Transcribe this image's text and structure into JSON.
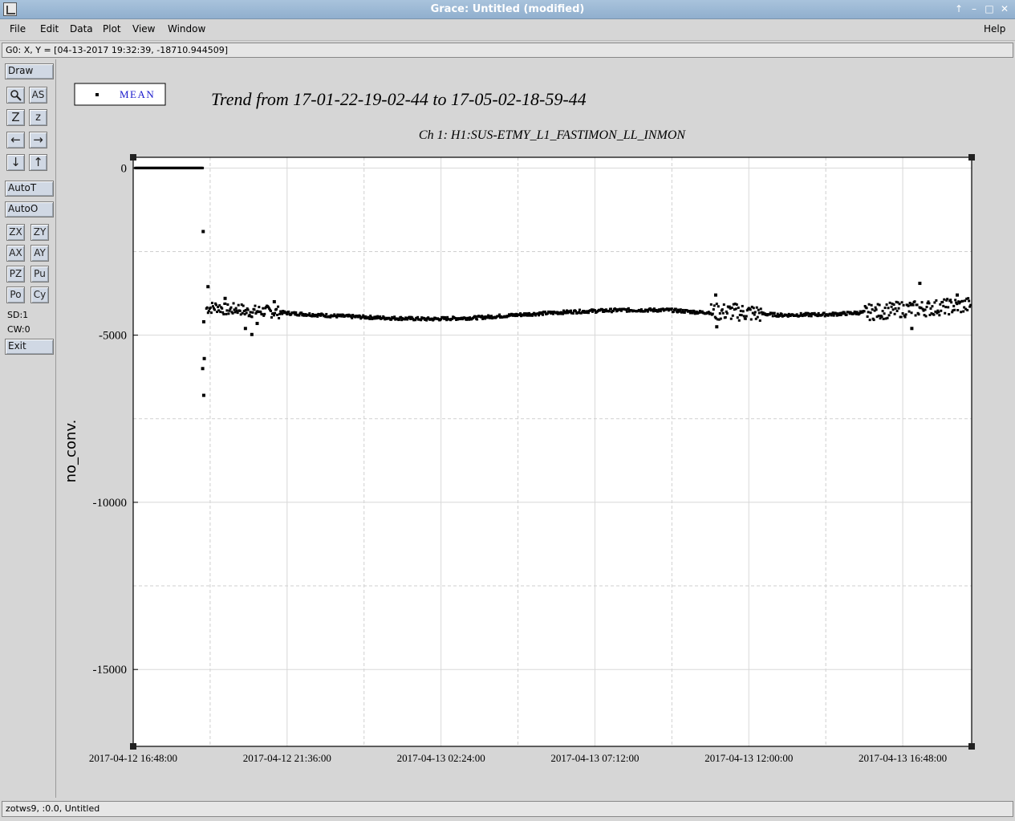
{
  "window": {
    "title": "Grace: Untitled (modified)",
    "controls": [
      "↑",
      "–",
      "□",
      "✕"
    ]
  },
  "menu": {
    "file": "File",
    "edit": "Edit",
    "data": "Data",
    "plot": "Plot",
    "view": "View",
    "window": "Window",
    "help": "Help"
  },
  "locator": "G0: X, Y = [04-13-2017 19:32:39, -18710.944509]",
  "toolbar": {
    "draw": "Draw",
    "zoom_icon": "magnifier-icon",
    "autoscale_text": "AS",
    "zoom_in": "Z",
    "zoom_out": "z",
    "left_arrow": "←",
    "right_arrow": "→",
    "down_arrow": "↓",
    "up_arrow": "↑",
    "autot": "AutoT",
    "autoo": "AutoO",
    "zx": "ZX",
    "zy": "ZY",
    "ax": "AX",
    "ay": "AY",
    "pz": "PZ",
    "pu": "Pu",
    "po": "Po",
    "cy": "Cy",
    "sd": "SD:1",
    "cw": "CW:0",
    "exit": "Exit"
  },
  "status": "zotws9, :0.0, Untitled",
  "chart_data": {
    "type": "scatter",
    "title": "Trend from 17-01-22-19-02-44 to 17-05-02-18-59-44",
    "subtitle": "Ch 1: H1:SUS-ETMY_L1_FASTIMON_LL_INMON",
    "ylabel": "no_conv.",
    "xlabel": "",
    "legend": {
      "placement": "top-left",
      "entries": [
        "MEAN"
      ]
    },
    "x_axis": {
      "min": "2017-04-12 16:48:00",
      "max": "2017-04-13 18:57:00",
      "tick_labels": [
        "2017-04-12 16:48:00",
        "2017-04-12 21:36:00",
        "2017-04-13 02:24:00",
        "2017-04-13 07:12:00",
        "2017-04-13 12:00:00",
        "2017-04-13 16:48:00"
      ]
    },
    "ylim": [
      -17300,
      320
    ],
    "y_ticks": [
      0,
      -5000,
      -10000,
      -15000
    ],
    "grid": true,
    "series": [
      {
        "name": "MEAN",
        "x": [
          "2017-04-12 16:52:00",
          "2017-04-12 17:30:00",
          "2017-04-12 18:10:00",
          "2017-04-12 18:58:00",
          "2017-04-12 19:05:00",
          "2017-04-12 19:25:00",
          "2017-04-12 19:45:00",
          "2017-04-12 20:05:00",
          "2017-04-12 20:20:00",
          "2017-04-12 20:45:00",
          "2017-04-12 21:10:00",
          "2017-04-12 21:45:00",
          "2017-04-12 23:00:00",
          "2017-04-13 00:30:00",
          "2017-04-13 02:00:00",
          "2017-04-13 03:30:00",
          "2017-04-13 05:00:00",
          "2017-04-13 06:30:00",
          "2017-04-13 08:00:00",
          "2017-04-13 09:30:00",
          "2017-04-13 10:30:00",
          "2017-04-13 11:30:00",
          "2017-04-13 13:00:00",
          "2017-04-13 14:30:00",
          "2017-04-13 16:00:00",
          "2017-04-13 16:45:00",
          "2017-04-13 17:30:00",
          "2017-04-13 18:10:00",
          "2017-04-13 18:55:00"
        ],
        "y": [
          0,
          0,
          0,
          0,
          -4200,
          -4150,
          -4250,
          -4200,
          -4300,
          -4280,
          -4300,
          -4350,
          -4420,
          -4480,
          -4520,
          -4480,
          -4380,
          -4300,
          -4250,
          -4250,
          -4320,
          -4300,
          -4400,
          -4380,
          -4300,
          -4230,
          -4200,
          -4150,
          -4100
        ]
      }
    ],
    "annotations": [
      {
        "x": "2017-04-12 18:59:00",
        "y": -1900
      },
      {
        "x": "2017-04-12 19:00:00",
        "y": -4600
      },
      {
        "x": "2017-04-12 19:01:00",
        "y": -5700
      },
      {
        "x": "2017-04-12 18:58:00",
        "y": -6000
      },
      {
        "x": "2017-04-12 19:00:00",
        "y": -6800
      },
      {
        "x": "2017-04-12 19:08:00",
        "y": -3550
      },
      {
        "x": "2017-04-12 19:40:00",
        "y": -3900
      },
      {
        "x": "2017-04-12 20:18:00",
        "y": -4800
      },
      {
        "x": "2017-04-12 20:30:00",
        "y": -4980
      },
      {
        "x": "2017-04-12 20:40:00",
        "y": -4650
      },
      {
        "x": "2017-04-12 21:12:00",
        "y": -4000
      },
      {
        "x": "2017-04-13 10:58:00",
        "y": -3800
      },
      {
        "x": "2017-04-13 11:00:00",
        "y": -4750
      },
      {
        "x": "2017-04-13 17:05:00",
        "y": -4800
      },
      {
        "x": "2017-04-13 17:20:00",
        "y": -3450
      },
      {
        "x": "2017-04-13 18:30:00",
        "y": -3800
      }
    ]
  }
}
